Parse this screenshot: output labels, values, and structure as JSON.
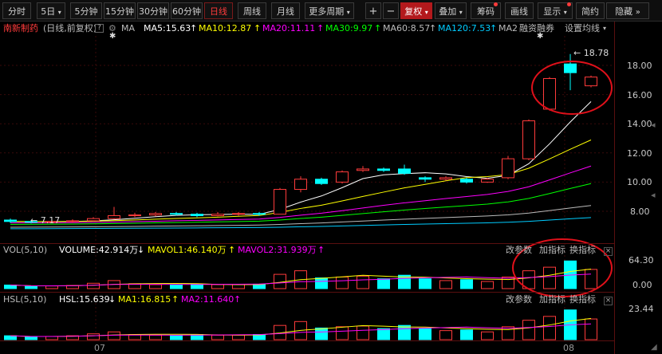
{
  "toolbar": {
    "period_buttons": [
      "分时",
      "5日",
      "5分钟",
      "15分钟",
      "30分钟",
      "60分钟",
      "日线",
      "周线",
      "月线",
      "更多周期"
    ],
    "active_period": "日线",
    "fuquan_label": "复权",
    "diejia_label": "叠加",
    "chouma_label": "筹码",
    "huaxian_label": "画线",
    "xianshi_label": "显示",
    "jianyue_label": "简约",
    "yincang_label": "隐藏",
    "plus": "+",
    "minus": "−"
  },
  "header": {
    "stock_name": "南新制药",
    "period_desc": "(日线,前复权)",
    "ma_label": "MA",
    "ma5": "MA5:15.63",
    "ma10": "MA10:12.87",
    "ma20": "MA20:11.11",
    "ma30": "MA30:9.97",
    "ma60": "MA60:8.57",
    "ma120": "MA120:7.53",
    "ma2_label": "MA2",
    "margin_label": "融资融券",
    "settings_label": "设置均线"
  },
  "price_axis": {
    "ticks": [
      "18.00",
      "16.00",
      "14.00",
      "12.00",
      "10.00",
      "8.00"
    ]
  },
  "annotations": {
    "high": "18.78",
    "low": "7.17"
  },
  "vol_panel": {
    "title": "VOL(5,10)",
    "volume": "VOLUME:42.914万",
    "mavol1": "MAVOL1:46.140万",
    "mavol2": "MAVOL2:31.939万",
    "change_param": "改参数",
    "add_indicator": "加指标",
    "switch_indicator": "换指标",
    "axis_top": "64.30",
    "axis_bottom": "0.00"
  },
  "hsl_panel": {
    "title": "HSL(5,10)",
    "hsl": "HSL:15.639",
    "ma1": "MA1:16.815",
    "ma2": "MA2:11.640",
    "change_param": "改参数",
    "add_indicator": "加指标",
    "switch_indicator": "换指标",
    "axis_top": "23.44"
  },
  "date_axis": {
    "labels": [
      "07",
      "08"
    ]
  },
  "colors": {
    "up": "#ff3b3b",
    "down": "#00ffff",
    "ma5": "#ffffff",
    "ma10": "#ffff00",
    "ma20": "#ff00ff",
    "ma30": "#00ff00",
    "ma60": "#bbbbbb",
    "ma120": "#00ccff",
    "highlight_circle": "#e0101a"
  },
  "chart_data": {
    "type": "candlestick",
    "candles": [
      {
        "o": 7.4,
        "c": 7.3,
        "h": 7.5,
        "l": 7.2
      },
      {
        "o": 7.3,
        "c": 7.25,
        "h": 7.4,
        "l": 7.17
      },
      {
        "o": 7.25,
        "c": 7.3,
        "h": 7.4,
        "l": 7.2
      },
      {
        "o": 7.3,
        "c": 7.35,
        "h": 7.45,
        "l": 7.22
      },
      {
        "o": 7.35,
        "c": 7.5,
        "h": 7.6,
        "l": 7.3
      },
      {
        "o": 7.5,
        "c": 7.7,
        "h": 8.3,
        "l": 7.45
      },
      {
        "o": 7.7,
        "c": 7.75,
        "h": 7.9,
        "l": 7.6
      },
      {
        "o": 7.75,
        "c": 7.85,
        "h": 7.95,
        "l": 7.65
      },
      {
        "o": 7.85,
        "c": 7.8,
        "h": 7.95,
        "l": 7.7
      },
      {
        "o": 7.8,
        "c": 7.7,
        "h": 7.9,
        "l": 7.6
      },
      {
        "o": 7.7,
        "c": 7.8,
        "h": 7.95,
        "l": 7.65
      },
      {
        "o": 7.8,
        "c": 7.85,
        "h": 7.95,
        "l": 7.7
      },
      {
        "o": 7.85,
        "c": 7.8,
        "h": 7.95,
        "l": 7.7
      },
      {
        "o": 7.8,
        "c": 9.5,
        "h": 9.6,
        "l": 7.8
      },
      {
        "o": 9.5,
        "c": 10.2,
        "h": 10.4,
        "l": 9.3
      },
      {
        "o": 10.2,
        "c": 9.9,
        "h": 10.3,
        "l": 9.8
      },
      {
        "o": 10.0,
        "c": 10.7,
        "h": 10.8,
        "l": 9.9
      },
      {
        "o": 10.8,
        "c": 10.9,
        "h": 11.1,
        "l": 10.7
      },
      {
        "o": 10.9,
        "c": 10.8,
        "h": 11.0,
        "l": 10.7
      },
      {
        "o": 10.9,
        "c": 10.6,
        "h": 11.2,
        "l": 10.5
      },
      {
        "o": 10.3,
        "c": 10.2,
        "h": 10.4,
        "l": 10.0
      },
      {
        "o": 10.2,
        "c": 10.3,
        "h": 10.4,
        "l": 10.1
      },
      {
        "o": 10.2,
        "c": 10.0,
        "h": 10.3,
        "l": 9.9
      },
      {
        "o": 10.0,
        "c": 10.2,
        "h": 10.3,
        "l": 9.95
      },
      {
        "o": 10.3,
        "c": 11.6,
        "h": 11.8,
        "l": 10.2
      },
      {
        "o": 11.6,
        "c": 14.2,
        "h": 14.3,
        "l": 11.5
      },
      {
        "o": 15.0,
        "c": 17.1,
        "h": 17.2,
        "l": 14.9
      },
      {
        "o": 18.1,
        "c": 17.5,
        "h": 18.78,
        "l": 16.3
      },
      {
        "o": 16.6,
        "c": 17.2,
        "h": 17.3,
        "l": 16.5
      }
    ],
    "volume": [
      8,
      5,
      6,
      7,
      12,
      18,
      11,
      9,
      8,
      10,
      9,
      9,
      10,
      32,
      40,
      24,
      26,
      28,
      22,
      30,
      22,
      18,
      20,
      16,
      26,
      40,
      48,
      62,
      43
    ],
    "hsl": [
      3,
      2,
      2.5,
      3,
      4.5,
      6,
      4,
      3.5,
      3,
      4,
      3.5,
      3.5,
      4,
      11,
      14,
      9,
      10,
      10.5,
      8.5,
      11,
      8.5,
      7,
      7.5,
      6,
      10,
      15,
      18,
      23,
      16
    ]
  }
}
